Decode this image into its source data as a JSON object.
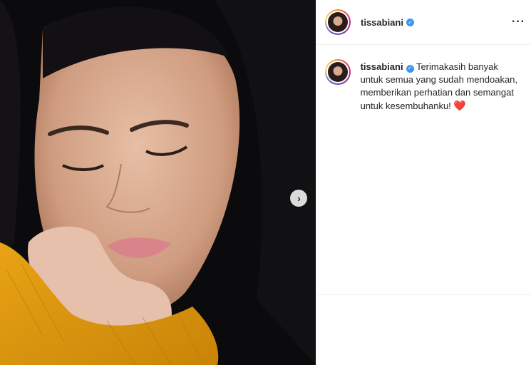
{
  "post": {
    "username": "tissabiani",
    "verified": true,
    "caption": "Terimakasih banyak untuk semua yang sudah mendoakan, memberikan perhatian dan semangat untuk kesembuhanku!",
    "caption_emoji": "❤️"
  },
  "header": {
    "username": "tissabiani",
    "more_icon": "more-horizontal-icon"
  },
  "carousel": {
    "next_icon": "chevron-right-icon"
  },
  "colors": {
    "verified_blue": "#3897f0",
    "heart_red": "#ed4956",
    "text": "#262626",
    "divider": "#efefef"
  }
}
